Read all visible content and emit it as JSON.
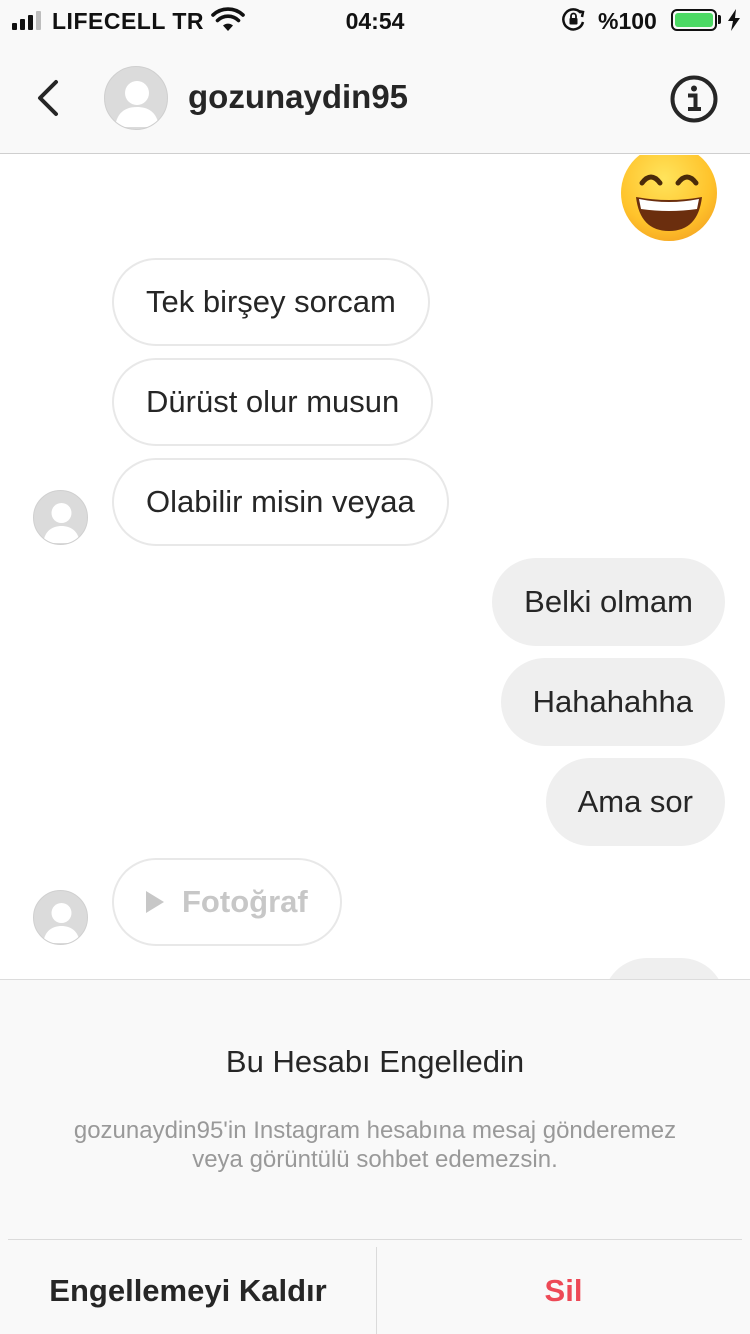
{
  "status_bar": {
    "carrier": "LIFECELL TR",
    "time": "04:54",
    "battery_percent": "%100",
    "battery_level": 1.0,
    "icons": [
      "signal-icon",
      "wifi-icon",
      "rotation-lock-icon",
      "battery-icon",
      "charging-bolt-icon"
    ]
  },
  "header": {
    "username": "gozunaydin95",
    "back_icon": "chevron-left-icon",
    "info_icon": "info-icon"
  },
  "messages": [
    {
      "direction": "out",
      "type": "emoji",
      "emoji": "😄"
    },
    {
      "direction": "in",
      "text": "Tek birşey sorcam"
    },
    {
      "direction": "in",
      "text": "Dürüst olur musun"
    },
    {
      "direction": "in",
      "text": "Olabilir misin veyaa"
    },
    {
      "direction": "out",
      "text": "Belki olmam"
    },
    {
      "direction": "out",
      "text": "Hahahahha"
    },
    {
      "direction": "out",
      "text": "Ama sor"
    },
    {
      "direction": "in",
      "type": "photo",
      "text": "Fotoğraf"
    }
  ],
  "blocked": {
    "title": "Bu Hesabı Engelledin",
    "description": "gozunaydin95'in Instagram hesabına mesaj gönderemez veya görüntülü sohbet edemezsin.",
    "unblock_label": "Engellemeyi Kaldır",
    "delete_label": "Sil"
  },
  "colors": {
    "delete_red": "#ed4956",
    "battery_green": "#4cd964",
    "bubble_out": "#efefef",
    "muted_text": "#999999"
  }
}
